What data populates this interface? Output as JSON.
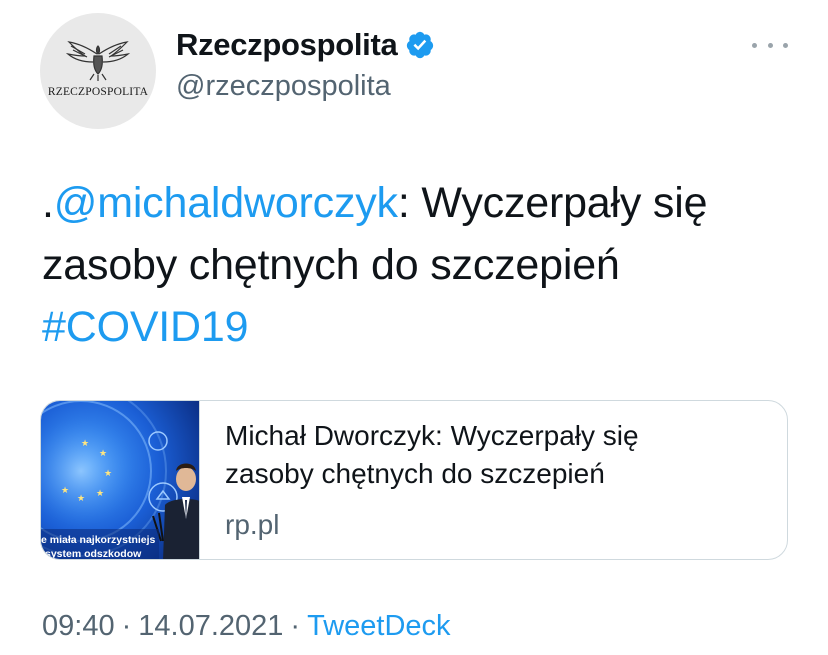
{
  "account": {
    "display_name": "Rzeczpospolita",
    "handle": "@rzeczpospolita",
    "avatar_wordmark": "RZECZPOSPOLITA",
    "verified_icon": "verified-badge-icon"
  },
  "more_icon": "more-options-icon",
  "tweet": {
    "line1_prefix": ".",
    "line1_mention": "@michaldworczyk",
    "line1_rest": ": Wyczerpały się",
    "line2": "zasoby chętnych do szczepień",
    "line3_hashtag": "#COVID19"
  },
  "card": {
    "title_line1": "Michał Dworczyk: Wyczerpały się",
    "title_line2": "zasoby chętnych do szczepień",
    "domain": "rp.pl",
    "thumb_caption_1": "e miała najkorzystniejs",
    "thumb_caption_2": "system odszkodow"
  },
  "meta": {
    "time": "09:40",
    "date": "14.07.2021",
    "separator": "·",
    "source": "TweetDeck"
  },
  "colors": {
    "link": "#1d9bf0",
    "text": "#0f1419",
    "secondary": "#536471",
    "border": "#cfd9de"
  }
}
